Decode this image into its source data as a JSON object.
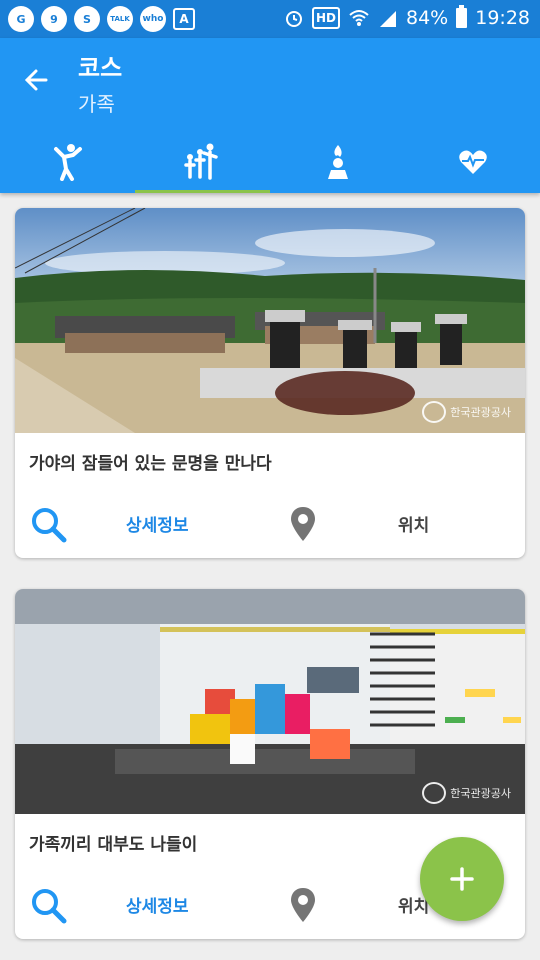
{
  "status_bar": {
    "icons": [
      "g-icon",
      "9-icon",
      "sync-icon",
      "talk-icon",
      "call-icon",
      "a-icon"
    ],
    "hd": "HD",
    "battery": "84%",
    "time": "19:28"
  },
  "app_bar": {
    "title": "코스",
    "subtitle": "가족",
    "tabs": [
      {
        "icon": "person-icon",
        "active": false
      },
      {
        "icon": "family-icon",
        "active": true
      },
      {
        "icon": "fire-statue-icon",
        "active": false
      },
      {
        "icon": "heartbeat-icon",
        "active": false
      }
    ]
  },
  "cards": [
    {
      "title": "가야의 잠들어 있는 문명을 만나다",
      "detail_label": "상세정보",
      "location_label": "위치",
      "watermark": "한국관광공사"
    },
    {
      "title": "가족끼리 대부도 나들이",
      "detail_label": "상세정보",
      "location_label": "위치",
      "watermark": "한국관광공사"
    }
  ],
  "fab": {
    "icon": "plus-icon"
  },
  "colors": {
    "primary": "#2196f3",
    "status": "#1a7fd6",
    "accent": "#8bc34a",
    "link": "#1e88e5"
  }
}
